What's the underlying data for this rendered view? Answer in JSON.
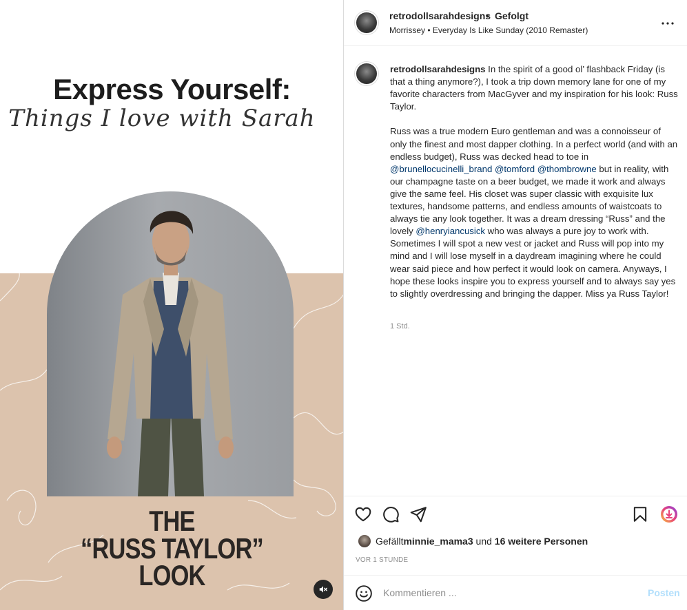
{
  "media": {
    "headline": "Express Yourself:",
    "subheadline": "Things I love with Sarah",
    "look_line1": "THE",
    "look_line2": "“RUSS TAYLOR”",
    "look_line3": "LOOK",
    "photo_subject": "man-in-tweed-jacket-photo",
    "colors": {
      "beige": "#dcc3ad",
      "arch_bg": "#9a9da1"
    }
  },
  "header": {
    "username": "retrodollsarahdesigns",
    "separator": "•",
    "follow_status": "Gefolgt",
    "music": "Morrissey • Everyday Is Like Sunday (2010 Remaster)"
  },
  "caption": {
    "username": "retrodollsarahdesigns",
    "p1": " In the spirit of a good ol’ flashback Friday (is that a thing anymore?), I took a trip down memory lane for one of my favorite characters from MacGyver and my inspiration for his look: Russ Taylor.",
    "p2_a": "Russ was a true modern Euro gentleman and was a connoisseur of only the finest and most dapper clothing. In a perfect world (and with an endless budget), Russ was decked head to toe in ",
    "mention1": "@brunellocucinelli_brand",
    "mention2": "@tomford",
    "mention3": "@thombrowne",
    "p2_b": " but in reality, with our champagne taste on a beer budget, we made it work and always give the same feel. His closet was super classic with exquisite lux textures, handsome patterns, and endless amounts of waistcoats to always tie any look together. It was a dream dressing “Russ” and the lovely ",
    "mention4": "@henryiancusick",
    "p2_c": " who was always a pure joy to work with. Sometimes I will spot a new vest or jacket and Russ will pop into my mind and I will lose myself in a daydream imagining where he could wear said piece and how perfect it would look on camera. Anyways, I hope these looks inspire you to express yourself and to always say yes to slightly overdressing and bringing the dapper. Miss ya Russ Taylor!",
    "time": "1 Std."
  },
  "actions": {
    "likes_prefix": "Gefällt ",
    "likes_user": "minnie_mama3",
    "likes_mid": " und ",
    "likes_others": "16 weitere Personen",
    "ago": "VOR 1 STUNDE"
  },
  "comment": {
    "placeholder": "Kommentieren ...",
    "post_label": "Posten"
  },
  "colors": {
    "link": "#00376b",
    "muted": "#8e8e8e",
    "post_disabled": "#b2dffc"
  }
}
